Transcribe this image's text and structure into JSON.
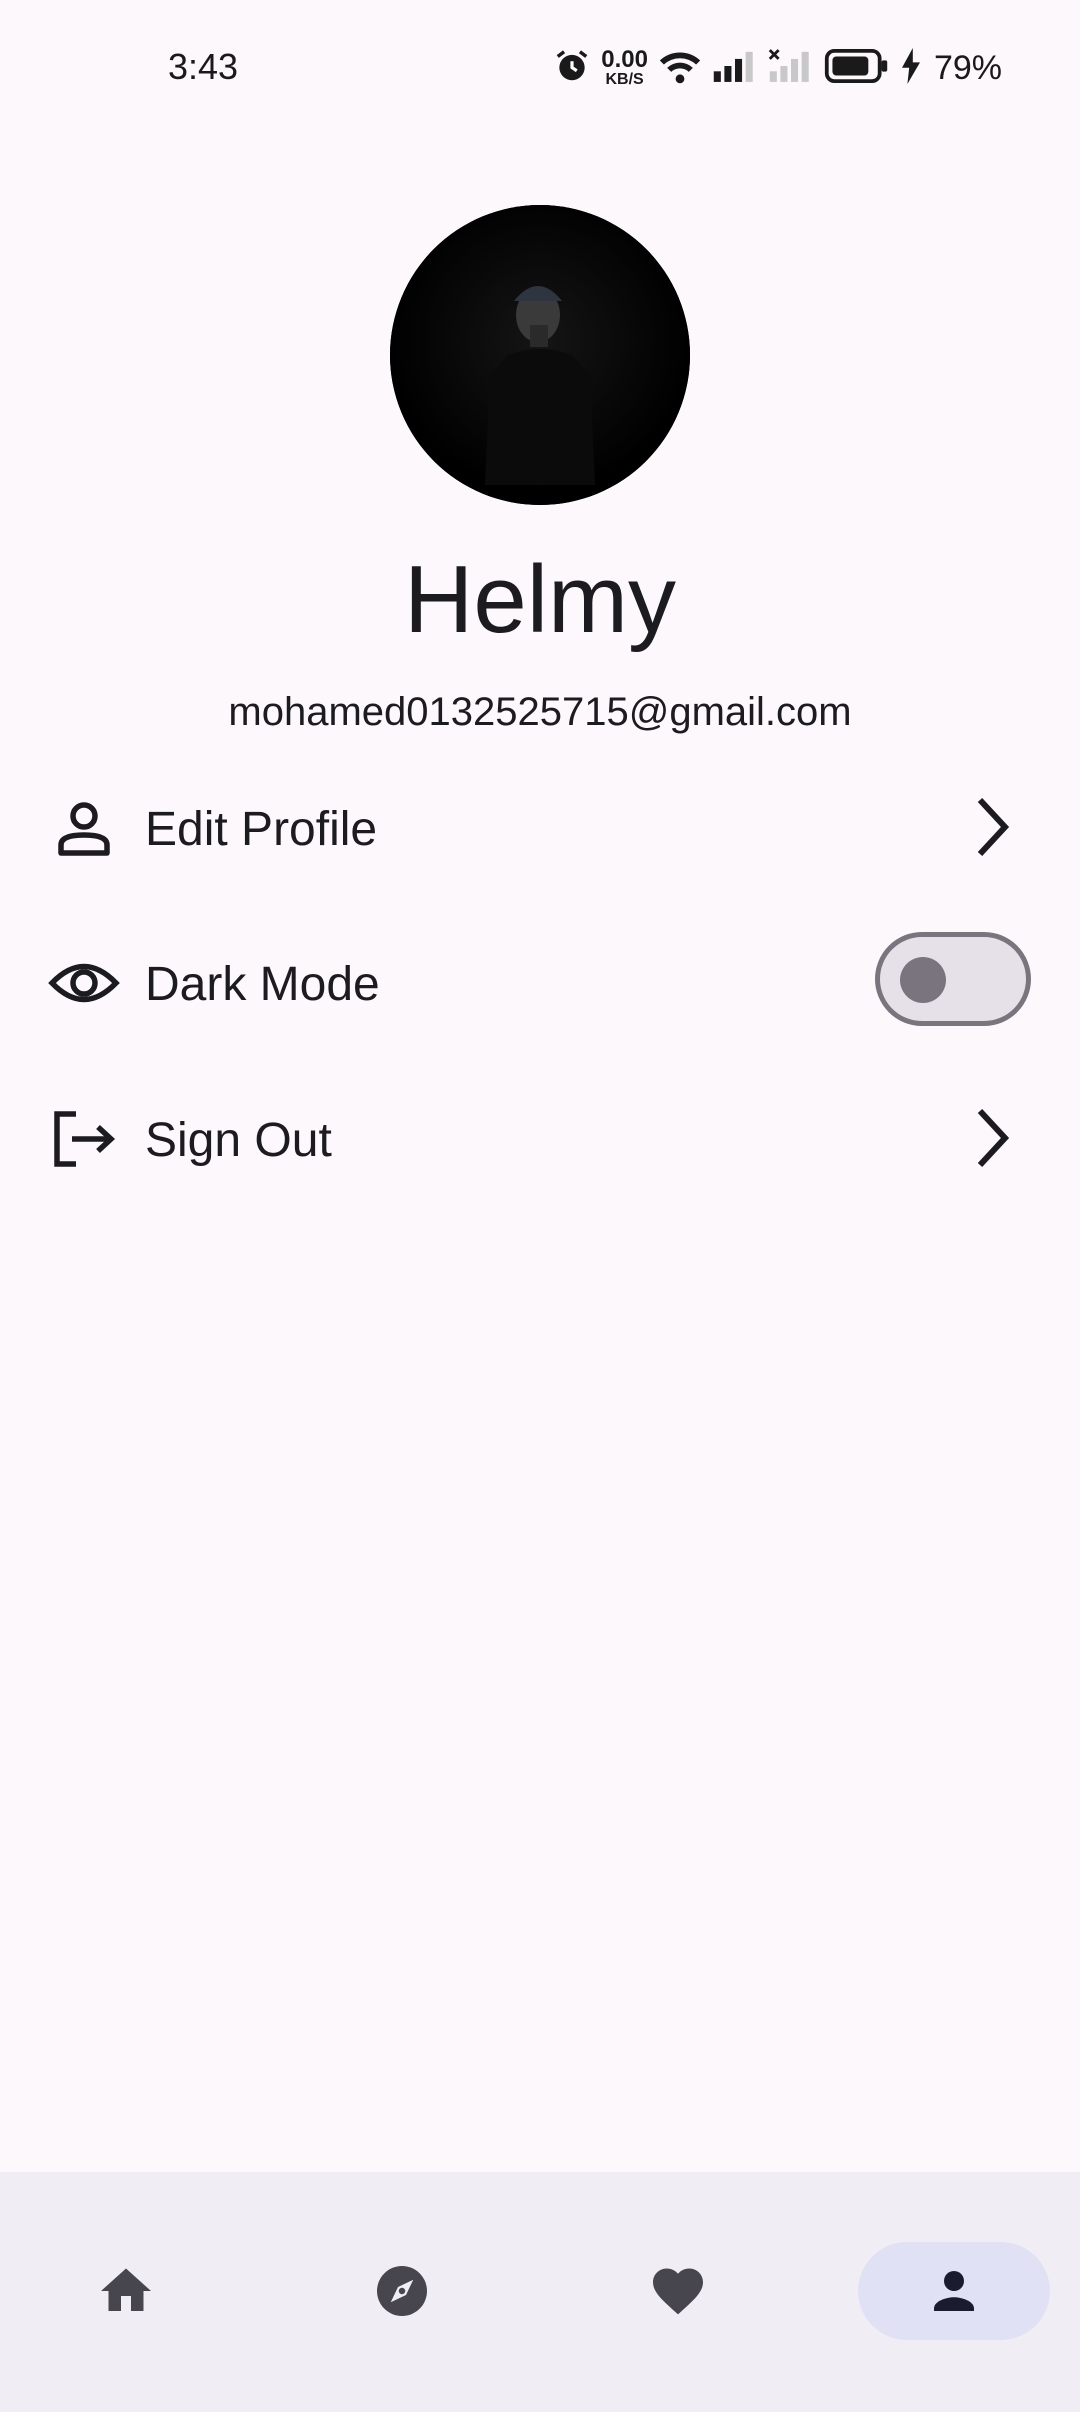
{
  "status_bar": {
    "time": "3:43",
    "net_speed_value": "0.00",
    "net_speed_unit": "KB/S",
    "battery_percent": "79%"
  },
  "profile": {
    "name": "Helmy",
    "email": "mohamed0132525715@gmail.com"
  },
  "menu": {
    "edit_profile": "Edit Profile",
    "dark_mode": "Dark Mode",
    "sign_out": "Sign Out"
  },
  "dark_mode_enabled": false,
  "bottom_nav": {
    "items": [
      {
        "icon": "home-icon",
        "active": false
      },
      {
        "icon": "explore-icon",
        "active": false
      },
      {
        "icon": "heart-icon",
        "active": false
      },
      {
        "icon": "person-icon",
        "active": true
      }
    ]
  },
  "colors": {
    "background": "#FDF8FB",
    "nav_background": "#F0EEF4",
    "active_indicator": "#E1E1F6",
    "switch_outline": "#79747E"
  }
}
